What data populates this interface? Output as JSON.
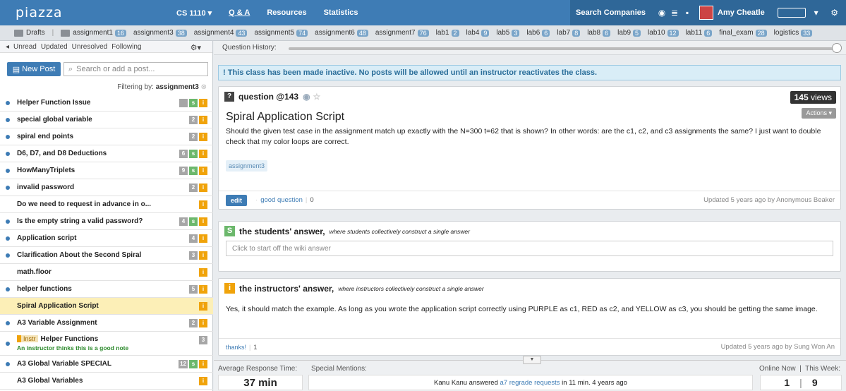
{
  "top": {
    "logo": "piazza",
    "course": "CS 1110 ▾",
    "nav": [
      "Q & A",
      "Resources",
      "Statistics"
    ],
    "search_companies": "Search Companies",
    "user": "Amy Cheatle"
  },
  "folders": [
    {
      "name": "Drafts",
      "count": ""
    },
    {
      "name": "assignment1",
      "count": "16"
    },
    {
      "name": "assignment3",
      "count": "38"
    },
    {
      "name": "assignment4",
      "count": "43"
    },
    {
      "name": "assignment5",
      "count": "74"
    },
    {
      "name": "assignment6",
      "count": "48"
    },
    {
      "name": "assignment7",
      "count": "76"
    },
    {
      "name": "lab1",
      "count": "2"
    },
    {
      "name": "lab4",
      "count": "9"
    },
    {
      "name": "lab5",
      "count": "3"
    },
    {
      "name": "lab6",
      "count": "6"
    },
    {
      "name": "lab7",
      "count": "8"
    },
    {
      "name": "lab8",
      "count": "6"
    },
    {
      "name": "lab9",
      "count": "5"
    },
    {
      "name": "lab10",
      "count": "12"
    },
    {
      "name": "lab11",
      "count": "6"
    },
    {
      "name": "final_exam",
      "count": "28"
    },
    {
      "name": "logistics",
      "count": "33"
    }
  ],
  "sidebar": {
    "filters": [
      "Unread",
      "Updated",
      "Unresolved",
      "Following"
    ],
    "new_post": "New Post",
    "search_placeholder": "Search or add a post...",
    "filtering_prefix": "Filtering by:",
    "filtering_value": "assignment3",
    "posts": [
      {
        "title": "Helper Function Issue",
        "dot": true,
        "badges": [
          "n",
          "s",
          "i"
        ],
        "n": ""
      },
      {
        "title": "special global variable",
        "dot": true,
        "badges": [
          "n",
          "i"
        ],
        "n": "2"
      },
      {
        "title": "spiral end points",
        "dot": true,
        "badges": [
          "n",
          "i"
        ],
        "n": "2"
      },
      {
        "title": "D6, D7, and D8 Deductions",
        "dot": true,
        "badges": [
          "n",
          "s",
          "i"
        ],
        "n": "6"
      },
      {
        "title": "HowManyTriplets",
        "dot": true,
        "badges": [
          "n",
          "s",
          "i"
        ],
        "n": "9"
      },
      {
        "title": "invalid password",
        "dot": true,
        "badges": [
          "n",
          "i"
        ],
        "n": "2"
      },
      {
        "title": "Do we need to request in advance in o...",
        "dot": false,
        "badges": [
          "i"
        ],
        "n": ""
      },
      {
        "title": "Is the empty string a valid password?",
        "dot": true,
        "badges": [
          "n",
          "s",
          "i"
        ],
        "n": "4"
      },
      {
        "title": "Application script",
        "dot": true,
        "badges": [
          "n",
          "i"
        ],
        "n": "4"
      },
      {
        "title": "Clarification About the Second Spiral",
        "dot": true,
        "badges": [
          "n",
          "i"
        ],
        "n": "3"
      },
      {
        "title": "math.floor",
        "dot": false,
        "badges": [
          "i"
        ],
        "n": ""
      },
      {
        "title": "helper functions",
        "dot": true,
        "badges": [
          "n",
          "i"
        ],
        "n": "5"
      },
      {
        "title": "Spiral Application Script",
        "dot": false,
        "badges": [
          "i"
        ],
        "n": "",
        "selected": true
      },
      {
        "title": "A3 Variable Assignment",
        "dot": true,
        "badges": [
          "n",
          "i"
        ],
        "n": "2"
      },
      {
        "title": "Helper Functions",
        "dot": true,
        "badges": [
          "n"
        ],
        "n": "3",
        "instr": "Instr",
        "note": "An instructor thinks this is a good note"
      },
      {
        "title": "A3 Global Variable SPECIAL",
        "dot": true,
        "badges": [
          "n",
          "s",
          "i"
        ],
        "n": "12"
      },
      {
        "title": "A3 Global Variables",
        "dot": false,
        "badges": [
          "i"
        ],
        "n": ""
      }
    ]
  },
  "main": {
    "history_label": "Question History:",
    "alert": "! This class has been made inactive. No posts will be allowed until an instructor reactivates the class.",
    "question": {
      "label": "question @143",
      "views_num": "145",
      "views_word": "views",
      "actions": "Actions ▾",
      "title": "Spiral Application Script",
      "body": "Should the given test case in the assignment match up exactly with the N=300 t=62 that is shown? In other words: are the c1, c2, and c3 assignments the same? I just want to double check that my color loops are correct.",
      "tag": "assignment3",
      "edit": "edit",
      "good_question": "good question",
      "good_count": "0",
      "updated": "Updated 5 years ago by Anonymous Beaker"
    },
    "students": {
      "icon": "S",
      "title": "the students' answer,",
      "sub": "where students collectively construct a single answer",
      "placeholder": "Click to start off the wiki answer"
    },
    "instructors": {
      "icon": "i",
      "title": "the instructors' answer,",
      "sub": "where instructors collectively construct a single answer",
      "body": "Yes, it should match the example. As long as you wrote the application script correctly using PURPLE as c1, RED as c2, and YELLOW as c3, you should be getting the same image.",
      "thanks": "thanks!",
      "thanks_count": "1",
      "updated": "Updated 5 years ago by Sung Won An"
    },
    "stats": {
      "avg_label": "Average Response Time:",
      "avg_value": "37 min",
      "mentions_label": "Special Mentions:",
      "mention_pre": "Kanu Kanu answered ",
      "mention_link": "a7 regrade requests",
      "mention_post": " in 11 min. 4 years ago",
      "online_label": "Online Now  |  This Week:",
      "online_now": "1",
      "this_week": "9"
    }
  }
}
